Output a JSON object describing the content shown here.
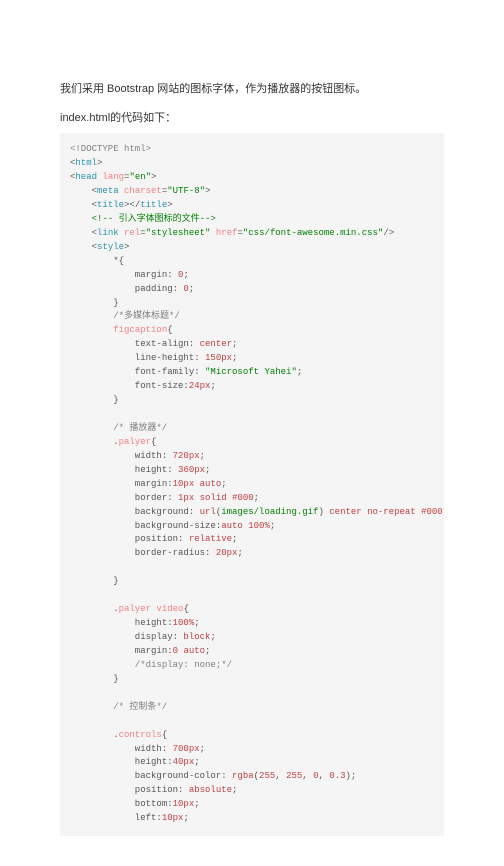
{
  "prose": {
    "p1": "我们采用 Bootstrap 网站的图标字体，作为播放器的按钮图标。",
    "p2": "index.html的代码如下："
  },
  "code": {
    "l1a": "<!DOCTYPE html>",
    "l2a": "<",
    "l2b": "html",
    "l2c": ">",
    "l3a": "<",
    "l3b": "head ",
    "l3c": "lang",
    "l3d": "=",
    "l3e": "\"en\"",
    "l3f": ">",
    "l4a": "    <",
    "l4b": "meta ",
    "l4c": "charset",
    "l4d": "=",
    "l4e": "\"UTF-8\"",
    "l4f": ">",
    "l5a": "    <",
    "l5b": "title",
    "l5c": "></",
    "l5d": "title",
    "l5e": ">",
    "l6a": "    <!-- 引入字体图标的文件-->",
    "l7a": "    <",
    "l7b": "link ",
    "l7c": "rel",
    "l7d": "=",
    "l7e": "\"stylesheet\" ",
    "l7f": "href",
    "l7g": "=",
    "l7h": "\"css/font-awesome.min.css\"",
    "l7i": "/>",
    "l8a": "    <",
    "l8b": "style",
    "l8c": ">",
    "l9a": "        *{",
    "l10a": "            margin: ",
    "l10b": "0",
    "l10c": ";",
    "l11a": "            padding: ",
    "l11b": "0",
    "l11c": ";",
    "l12a": "        }",
    "l13a": "        /*多媒体标题*/",
    "l14a": "        ",
    "l14b": "figcaption",
    "l14c": "{",
    "l15a": "            text-align: ",
    "l15b": "center",
    "l15c": ";",
    "l16a": "            line-height: ",
    "l16b": "150px",
    "l16c": ";",
    "l17a": "            font-family: ",
    "l17b": "\"Microsoft Yahei\"",
    "l17c": ";",
    "l18a": "            font-size:",
    "l18b": "24px",
    "l18c": ";",
    "l19a": "        }",
    "l20": "",
    "l21a": "        /* 播放器*/",
    "l22a": "        .",
    "l22b": "palyer",
    "l22c": "{",
    "l23a": "            width: ",
    "l23b": "720px",
    "l23c": ";",
    "l24a": "            height: ",
    "l24b": "360px",
    "l24c": ";",
    "l25a": "            margin:",
    "l25b": "10px ",
    "l25c": "auto",
    "l25d": ";",
    "l26a": "            border: ",
    "l26b": "1px ",
    "l26c": "solid ",
    "l26d": "#000",
    "l26e": ";",
    "l27a": "            background: ",
    "l27b": "url",
    "l27c": "(",
    "l27d": "images/loading.gif",
    "l27e": ") ",
    "l27f": "center ",
    "l27g": "no-repeat ",
    "l27h": "#000",
    "l27i": ";",
    "l28a": "            background-size:",
    "l28b": "auto ",
    "l28c": "100%",
    "l28d": ";",
    "l29a": "            position: ",
    "l29b": "relative",
    "l29c": ";",
    "l30a": "            border-radius: ",
    "l30b": "20px",
    "l30c": ";",
    "l31": "",
    "l32a": "        }",
    "l33": "",
    "l34a": "        .",
    "l34b": "palyer ",
    "l34c": "video",
    "l34d": "{",
    "l35a": "            height:",
    "l35b": "100%",
    "l35c": ";",
    "l36a": "            display: ",
    "l36b": "block",
    "l36c": ";",
    "l37a": "            margin:",
    "l37b": "0 ",
    "l37c": "auto",
    "l37d": ";",
    "l38a": "            /*display: none;*/",
    "l39a": "        }",
    "l40": "",
    "l41a": "        /* 控制条*/",
    "l42": "",
    "l43a": "        .",
    "l43b": "controls",
    "l43c": "{",
    "l44a": "            width: ",
    "l44b": "700px",
    "l44c": ";",
    "l45a": "            height:",
    "l45b": "40px",
    "l45c": ";",
    "l46a": "            background-color: ",
    "l46b": "rgba",
    "l46c": "(",
    "l46d": "255",
    "l46e": ", ",
    "l46f": "255",
    "l46g": ", ",
    "l46h": "0",
    "l46i": ", ",
    "l46j": "0.3",
    "l46k": ");",
    "l47a": "            position: ",
    "l47b": "absolute",
    "l47c": ";",
    "l48a": "            bottom:",
    "l48b": "10px",
    "l48c": ";",
    "l49a": "            left:",
    "l49b": "10px",
    "l49c": ";"
  }
}
